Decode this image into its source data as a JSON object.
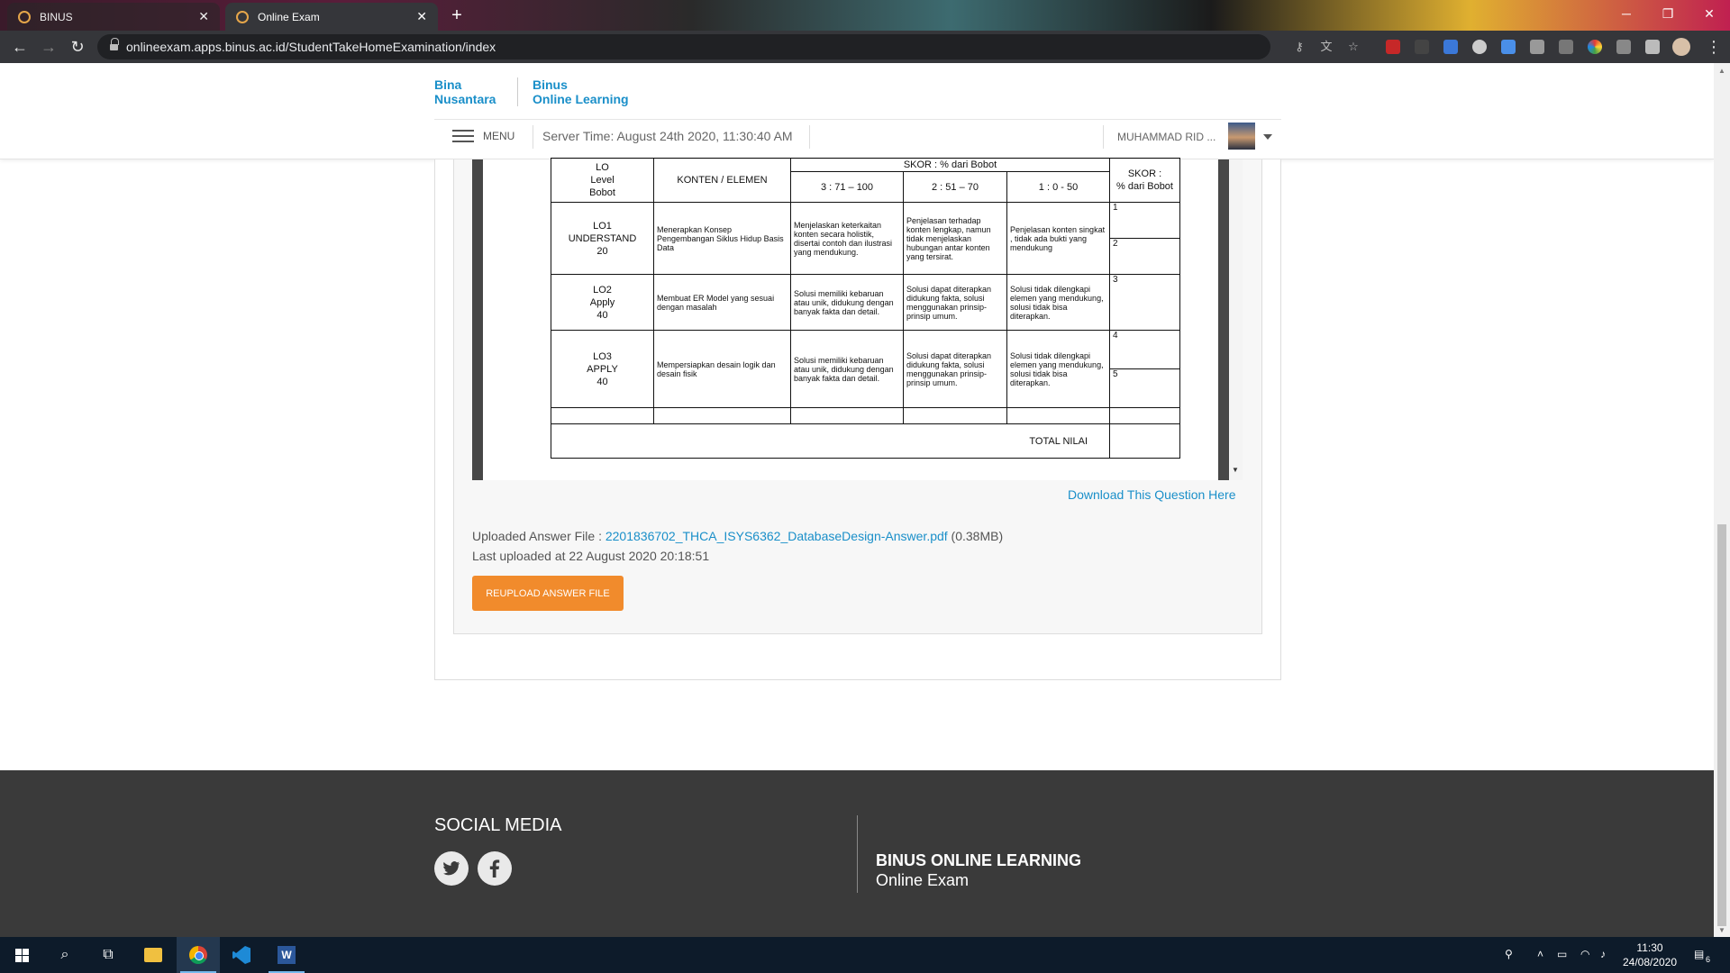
{
  "browser": {
    "tabs": [
      {
        "label": "BINUS",
        "active": false
      },
      {
        "label": "Online Exam",
        "active": true
      }
    ],
    "url": "onlineexam.apps.binus.ac.id/StudentTakeHomeExamination/index"
  },
  "header": {
    "logo_left": [
      "Bina",
      "Nusantara"
    ],
    "logo_right": [
      "Binus",
      "Online Learning"
    ],
    "menu_label": "MENU",
    "server_time": "Server Time: August 24th 2020, 11:30:40 AM",
    "user_name": "MUHAMMAD RID ..."
  },
  "rubric": {
    "header": {
      "lo": [
        "LO",
        "Level",
        "Bobot"
      ],
      "konten": "KONTEN / ELEMEN",
      "skor": "SKOR :  % dari Bobot",
      "ranges": [
        "3 : 71 – 100",
        "2 : 51 – 70",
        "1 : 0 - 50"
      ],
      "skor_right": [
        "SKOR :",
        "% dari Bobot"
      ]
    },
    "rows": [
      {
        "lo": [
          "LO1",
          "UNDERSTAND",
          "20"
        ],
        "konten": "Menerapkan Konsep Pengembangan Siklus Hidup Basis Data",
        "s3": "Menjelaskan keterkaitan konten secara holistik, disertai contoh dan ilustrasi yang mendukung.",
        "s2": "Penjelasan terhadap konten lengkap, namun tidak menjelaskan hubungan antar konten yang tersirat.",
        "s1": "Penjelasan konten singkat , tidak ada bukti yang mendukung",
        "nums": [
          "1",
          "2"
        ]
      },
      {
        "lo": [
          "LO2",
          "Apply",
          "40"
        ],
        "konten": "Membuat ER Model yang sesuai dengan masalah",
        "s3": "Solusi memiliki kebaruan atau unik, didukung dengan banyak fakta dan detail.",
        "s2": "Solusi dapat diterapkan didukung fakta, solusi menggunakan prinsip-prinsip umum.",
        "s1": "Solusi tidak dilengkapi elemen yang mendukung, solusi tidak bisa diterapkan.",
        "nums": [
          "3"
        ]
      },
      {
        "lo": [
          "LO3",
          "APPLY",
          "40"
        ],
        "konten": "Mempersiapkan desain logik dan desain fisik",
        "s3": "Solusi memiliki kebaruan atau unik, didukung dengan banyak fakta dan detail.",
        "s2": "Solusi dapat diterapkan didukung fakta, solusi menggunakan prinsip-prinsip umum.",
        "s1": "Solusi tidak dilengkapi elemen yang mendukung, solusi tidak bisa diterapkan.",
        "nums": [
          "4",
          "5"
        ]
      }
    ],
    "total_label": "TOTAL NILAI"
  },
  "main": {
    "download_link": "Download This Question Here",
    "uploaded_label": "Uploaded Answer File : ",
    "uploaded_file": "2201836702_THCA_ISYS6362_DatabaseDesign-Answer.pdf",
    "uploaded_size": " (0.38MB)",
    "last_uploaded": "Last uploaded at 22 August 2020 20:18:51",
    "reupload_button": "REUPLOAD ANSWER FILE"
  },
  "footer": {
    "social_title": "SOCIAL MEDIA",
    "brand": "BINUS ONLINE LEARNING",
    "sub": "Online Exam"
  },
  "taskbar": {
    "time": "11:30",
    "date": "24/08/2020",
    "notification_count": "6"
  },
  "colors": {
    "brand_blue": "#1a8fc9",
    "button_orange": "#f18b2c",
    "footer_bg": "#3a3a3a"
  }
}
